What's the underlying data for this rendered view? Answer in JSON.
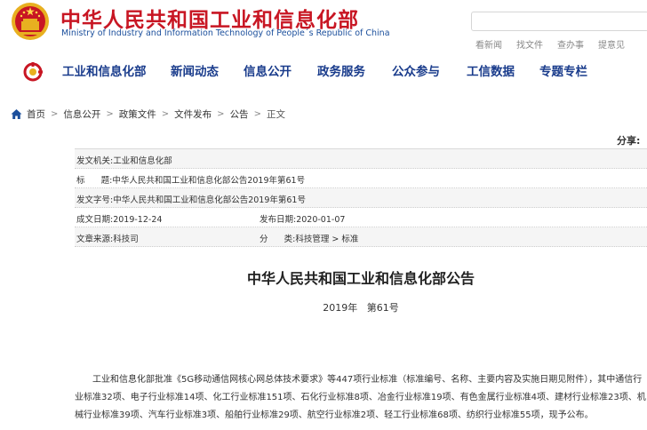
{
  "header": {
    "title_cn": "中华人民共和国工业和信息化部",
    "title_en": "Ministry of Industry and Information Technology of People´s Republic of China",
    "search_placeholder": "",
    "quick_links": [
      "看新闻",
      "找文件",
      "查办事",
      "提意见"
    ]
  },
  "nav": {
    "items": [
      "工业和信息化部",
      "新闻动态",
      "信息公开",
      "政务服务",
      "公众参与",
      "工信数据",
      "专题专栏"
    ]
  },
  "breadcrumb": {
    "items": [
      "首页",
      "信息公开",
      "政策文件",
      "文件发布",
      "公告",
      "正文"
    ],
    "separator": ">"
  },
  "share_label": "分享:",
  "info": {
    "issuer_label": "发文机关:",
    "issuer": "工业和信息化部",
    "title_label": "标      题:",
    "title": "中华人民共和国工业和信息化部公告2019年第61号",
    "doc_no_label": "发文字号:",
    "doc_no": "中华人民共和国工业和信息化部公告2019年第61号",
    "created_label": "成文日期:",
    "created": "2019-12-24",
    "published_label": "发布日期:",
    "published": "2020-01-07",
    "source_label": "文章来源:",
    "source": "科技司",
    "category_label": "分      类:",
    "category": "科技管理 > 标准"
  },
  "article": {
    "title": "中华人民共和国工业和信息化部公告",
    "number": "2019年   第61号",
    "body": "工业和信息化部批准《5G移动通信网核心网总体技术要求》等447项行业标准（标准编号、名称、主要内容及实施日期见附件），其中通信行业标准32项、电子行业标准14项、化工行业标准151项、石化行业标准8项、冶金行业标准19项、有色金属行业标准4项、建材行业标准23项、机械行业标准39项、汽车行业标准3项、船舶行业标准29项、航空行业标准2项、轻工行业标准68项、纺织行业标准55项，现予公布。"
  },
  "colors": {
    "brand_red": "#c81623",
    "nav_blue": "#1a3c8c",
    "en_blue": "#1b4f9c",
    "gold": "#e8b020"
  }
}
